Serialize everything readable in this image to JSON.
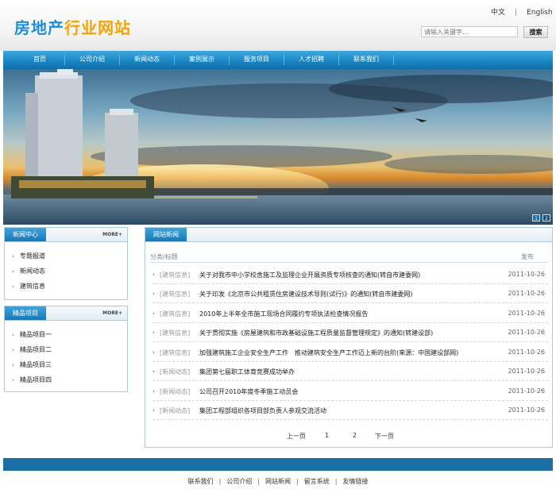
{
  "header": {
    "logo_part1": "房地产",
    "logo_part2": "行业网站",
    "lang_cn": "中文",
    "lang_sep": "|",
    "lang_en": "English",
    "search_placeholder": "请输入关键字...",
    "search_button": "搜索"
  },
  "nav": [
    "首页",
    "公司介绍",
    "新闻动态",
    "案例展示",
    "服务项目",
    "人才招聘",
    "联系我们"
  ],
  "banner": {
    "ctrl": [
      "1",
      "2"
    ]
  },
  "news_center": {
    "title": "新闻中心",
    "more": "MORE+",
    "items": [
      "专题报道",
      "新闻动态",
      "建筑信息"
    ]
  },
  "products": {
    "title": "精品项目",
    "more": "MORE+",
    "items": [
      "精品项目一",
      "精品项目二",
      "精品项目三",
      "精品项目四"
    ]
  },
  "site_news": {
    "title": "网站新闻",
    "col_left": "分类/标题",
    "col_right": "发布",
    "rows": [
      {
        "cat": "[建筑信息]",
        "title": "关于对我市中小学校舍施工及监理企业开展资质专项核查的通知(转自市建委网)",
        "date": "2011-10-26"
      },
      {
        "cat": "[建筑信息]",
        "title": "关于印发《北京市公共租赁住房建设技术导则(试行)》的通知(转自市建委网)",
        "date": "2011-10-26"
      },
      {
        "cat": "[建筑信息]",
        "title": "2010年上半年全市施工现场合同履约专项执法检查情况报告",
        "date": "2011-10-26"
      },
      {
        "cat": "[建筑信息]",
        "title": "关于贯彻实施《房屋建筑和市政基础设施工程质量监督管理规定》的通知(转建设部)",
        "date": "2011-10-26"
      },
      {
        "cat": "[建筑信息]",
        "title": "加强建筑施工企业安全生产工作　推动建筑安全生产工作迈上新的台阶(来源：中国建设部网)",
        "date": "2011-10-26"
      },
      {
        "cat": "[新闻动态]",
        "title": "集团第七届职工体育竞赛成功举办",
        "date": "2011-10-26"
      },
      {
        "cat": "[新闻动态]",
        "title": "公司召开2010年度冬季施工动员会",
        "date": "2011-10-26"
      },
      {
        "cat": "[新闻动态]",
        "title": "集团工程部组织各项目部负责人参观交流活动",
        "date": "2011-10-26"
      }
    ],
    "pager": {
      "prev": "上一页",
      "p1": "1",
      "p2": "2",
      "next": "下一页"
    }
  },
  "footer": {
    "links": [
      "联系我们",
      "公司介绍",
      "网站新闻",
      "留言系统",
      "友情链接"
    ],
    "sep": "|"
  }
}
